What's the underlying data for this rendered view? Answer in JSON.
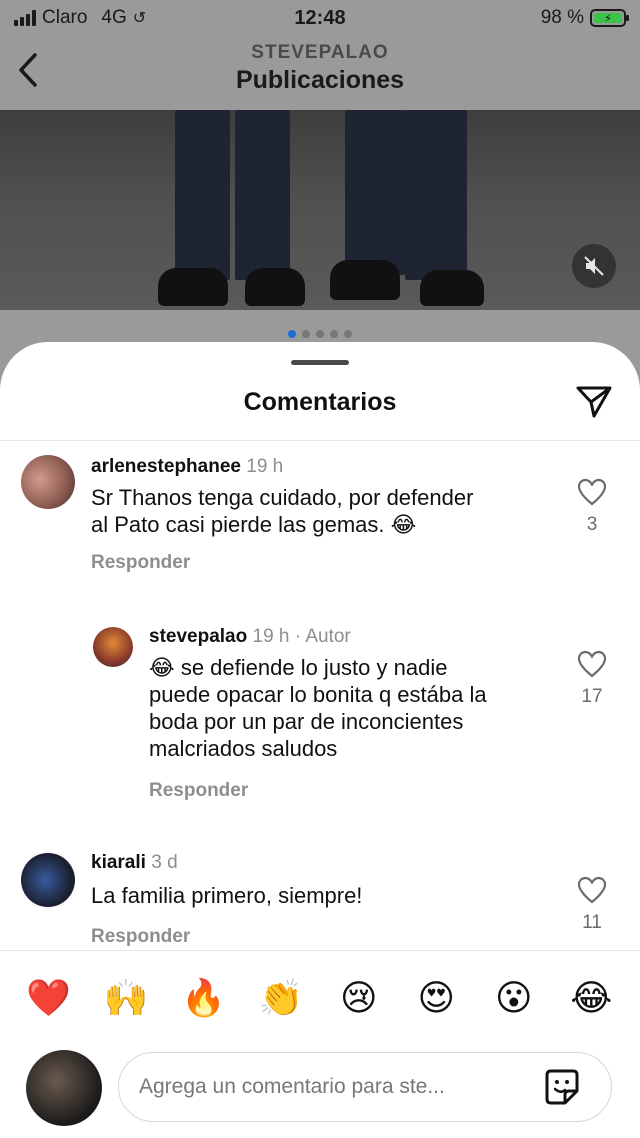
{
  "status_bar": {
    "carrier": "Claro",
    "network": "4G",
    "time": "12:48",
    "battery": "98 %"
  },
  "nav": {
    "subtitle": "STEVEPALAO",
    "title": "Publicaciones"
  },
  "sheet": {
    "title": "Comentarios"
  },
  "comments": [
    {
      "user": "arlenestephanee",
      "meta": "19 h",
      "text_lines": [
        "Sr Thanos tenga cuidado, por defender",
        "al Pato casi pierde las gemas. 😂"
      ],
      "reply": "Responder",
      "likes": "3"
    },
    {
      "user": "stevepalao",
      "meta": "19 h · Autor",
      "text_lines": [
        "😂 se defiende lo justo y nadie",
        "puede opacar lo bonita q estába la",
        "boda por un par de inconcientes",
        "malcriados  saludos"
      ],
      "reply": "Responder",
      "likes": "17"
    },
    {
      "user": "kiarali",
      "meta": "3 d",
      "text_lines": [
        "La familia primero, siempre!"
      ],
      "reply": "Responder",
      "likes": "11"
    }
  ],
  "emoji_bar": [
    "❤️",
    "🙌",
    "🔥",
    "👏",
    "😢",
    "😍",
    "😮",
    "😂"
  ],
  "composer": {
    "placeholder": "Agrega un comentario para ste..."
  },
  "colors": {
    "accent_blue": "#1a6fd6",
    "battery_green": "#3cc24a",
    "muted_text": "#8e8e8e"
  },
  "icons": [
    "signal-icon",
    "link-icon",
    "battery-icon",
    "back-arrow-icon",
    "mute-icon",
    "send-icon",
    "heart-icon",
    "sticker-icon"
  ]
}
